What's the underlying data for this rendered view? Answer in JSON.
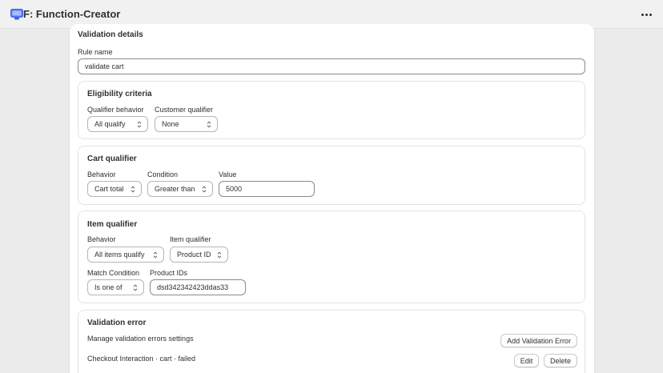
{
  "app": {
    "title": "F: Function-Creator",
    "icon": "app-icon"
  },
  "validation_details": {
    "title": "Validation details",
    "rule_name_label": "Rule name",
    "rule_name_value": "validate cart"
  },
  "eligibility": {
    "title": "Eligibility criteria",
    "qualifier_behavior_label": "Qualifier behavior",
    "qualifier_behavior_value": "All qualify",
    "customer_qualifier_label": "Customer qualifier",
    "customer_qualifier_value": "None"
  },
  "cart_qualifier": {
    "title": "Cart qualifier",
    "behavior_label": "Behavior",
    "behavior_value": "Cart total",
    "condition_label": "Condition",
    "condition_value": "Greater than",
    "value_label": "Value",
    "value_value": "5000"
  },
  "item_qualifier": {
    "title": "Item qualifier",
    "behavior_label": "Behavior",
    "behavior_value": "All items qualify",
    "item_qualifier_label": "Item qualifier",
    "item_qualifier_value": "Product ID",
    "match_condition_label": "Match Condition",
    "match_condition_value": "Is one of",
    "product_ids_label": "Product IDs",
    "product_ids_value": "dsd342342423ddas33"
  },
  "validation_error": {
    "title": "Validation error",
    "manage_text": "Manage validation errors settings",
    "add_button": "Add Validation Error",
    "error_entry": "Checkout Interaction · cart · failed",
    "edit_button": "Edit",
    "delete_button": "Delete"
  },
  "colors": {
    "background": "#ebebeb",
    "card": "#ffffff",
    "icon_blue": "#4a6cf7"
  }
}
